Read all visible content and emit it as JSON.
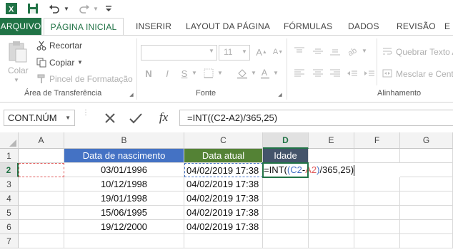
{
  "qat": {
    "app_icon": "excel-icon",
    "save_icon": "save-icon",
    "undo_icon": "undo-icon",
    "redo_icon": "redo-icon"
  },
  "tabs": {
    "file": "ARQUIVO",
    "home": "PÁGINA INICIAL",
    "insert": "INSERIR",
    "layout": "LAYOUT DA PÁGINA",
    "formulas": "FÓRMULAS",
    "data": "DADOS",
    "review": "REVISÃO",
    "view": "E"
  },
  "ribbon": {
    "paste": "Colar",
    "cut": "Recortar",
    "copy": "Copiar",
    "format_painter": "Pincel de Formatação",
    "clipboard_group": "Área de Transferência",
    "font_size": "11",
    "bold": "N",
    "italic": "I",
    "underline": "S",
    "font_group": "Fonte",
    "wrap_text": "Quebrar Texto A",
    "merge_center": "Mesclar e Cent",
    "alignment_group": "Alinhamento"
  },
  "formula_bar": {
    "name_box": "CONT.NÚM",
    "fx": "fx",
    "formula": "=INT((C2-A2)/365,25)"
  },
  "columns": [
    "A",
    "B",
    "C",
    "D",
    "E",
    "F",
    "G"
  ],
  "rows": [
    "1",
    "2",
    "3",
    "4",
    "5",
    "6",
    "7"
  ],
  "sheet": {
    "headers": {
      "b": "Data de nascimento",
      "c": "Data atual",
      "d": "Idade"
    },
    "birth_dates": [
      "03/01/1996",
      "10/12/1998",
      "19/01/1998",
      "15/06/1995",
      "19/12/2000"
    ],
    "current_dates": [
      "04/02/2019 17:38",
      "04/02/2019 17:38",
      "04/02/2019 17:38",
      "04/02/2019 17:38",
      "04/02/2019 17:38"
    ],
    "edit_cell": {
      "p1": "=INT(",
      "p2": "(",
      "ref1": "C2",
      "minus": "-",
      "ref2": "A2",
      "p3": ")",
      "rest": "/365,25)"
    }
  },
  "colors": {
    "excel_green": "#217346",
    "ref_blue": "#4472c4",
    "ref_red": "#e05c5c"
  }
}
